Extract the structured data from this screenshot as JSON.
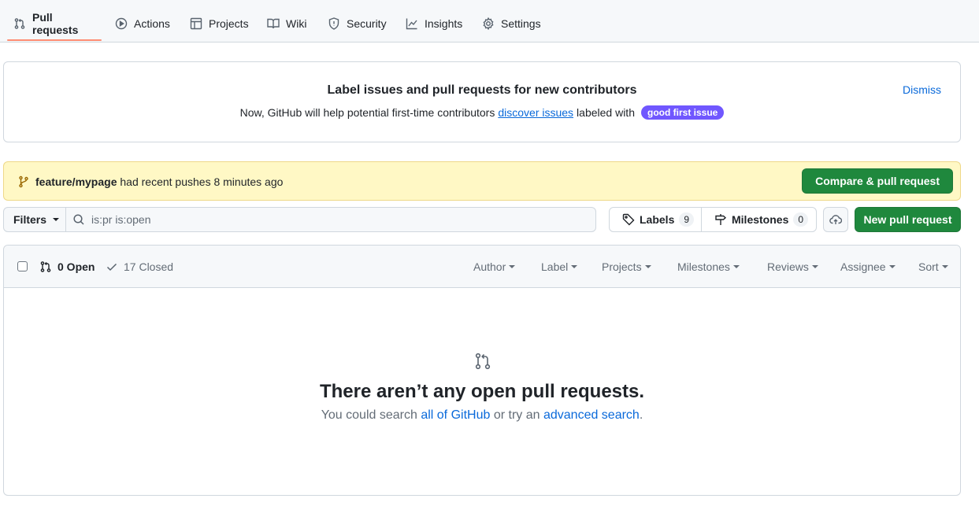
{
  "nav": {
    "tabs": [
      {
        "label": "Pull requests",
        "icon": "git-pull-request-icon",
        "active": true
      },
      {
        "label": "Actions",
        "icon": "play-icon"
      },
      {
        "label": "Projects",
        "icon": "table-icon"
      },
      {
        "label": "Wiki",
        "icon": "book-icon"
      },
      {
        "label": "Security",
        "icon": "shield-icon"
      },
      {
        "label": "Insights",
        "icon": "graph-icon"
      },
      {
        "label": "Settings",
        "icon": "gear-icon"
      }
    ]
  },
  "banner": {
    "title": "Label issues and pull requests for new contributors",
    "text_before": "Now, GitHub will help potential first-time contributors",
    "link": "discover issues",
    "text_after": "labeled with",
    "label": "good first issue",
    "dismiss": "Dismiss"
  },
  "push_alert": {
    "branch": "feature/mypage",
    "message": "had recent pushes 8 minutes ago",
    "button": "Compare & pull request"
  },
  "toolbar": {
    "filters": "Filters",
    "search_value": "is:pr is:open",
    "labels": "Labels",
    "labels_count": "9",
    "milestones": "Milestones",
    "milestones_count": "0",
    "new_pr": "New pull request"
  },
  "list": {
    "open": "0 Open",
    "closed": "17 Closed",
    "filters": [
      "Author",
      "Label",
      "Projects",
      "Milestones",
      "Reviews",
      "Assignee",
      "Sort"
    ]
  },
  "empty": {
    "title": "There aren’t any open pull requests.",
    "sub_before": "You could search",
    "sub_link1": "all of GitHub",
    "sub_mid": "or try an",
    "sub_link2": "advanced search",
    "sub_end": "."
  },
  "colors": {
    "accent_green": "#1f883d",
    "link_blue": "#0969da",
    "label_purple": "#7057ff",
    "alert_yellow": "#fff8c5",
    "tab_underline": "#fd8c73"
  }
}
